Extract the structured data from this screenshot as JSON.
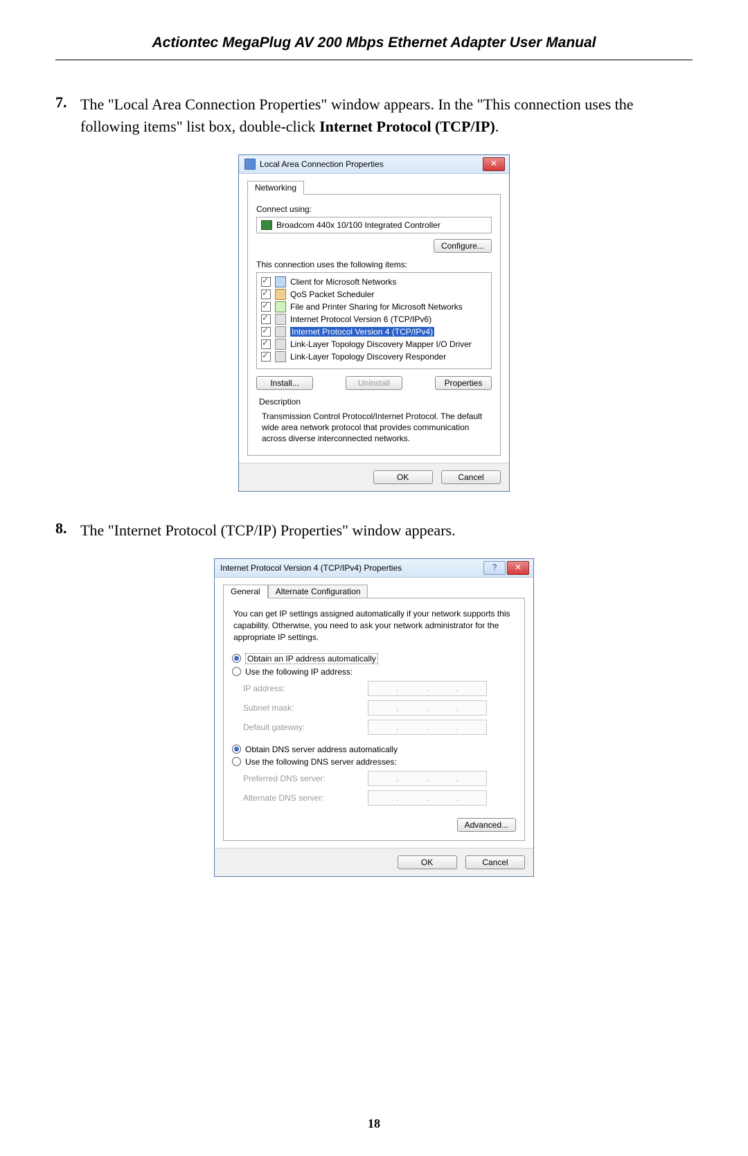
{
  "header": {
    "title": "Actiontec MegaPlug AV 200 Mbps Ethernet Adapter User Manual"
  },
  "page_number": "18",
  "step7": {
    "num": "7.",
    "pre": "The \"Local Area Connection Properties\" window appears. In the \"This connection uses the following items\" list box, double-click ",
    "bold": "Internet Protocol (TCP/IP)",
    "post": "."
  },
  "step8": {
    "num": "8.",
    "pre": "The \"Internet Protocol (",
    "sc": "TCP/IP",
    "post": ") Properties\" window appears."
  },
  "dlg1": {
    "title": "Local Area Connection Properties",
    "tab": "Networking",
    "connect_using": "Connect using:",
    "adapter": "Broadcom 440x 10/100 Integrated Controller",
    "configure": "Configure...",
    "uses_label": "This connection uses the following items:",
    "items": {
      "i0": "Client for Microsoft Networks",
      "i1": "QoS Packet Scheduler",
      "i2": "File and Printer Sharing for Microsoft Networks",
      "i3": "Internet Protocol Version 6 (TCP/IPv6)",
      "i4": "Internet Protocol Version 4 (TCP/IPv4)",
      "i5": "Link-Layer Topology Discovery Mapper I/O Driver",
      "i6": "Link-Layer Topology Discovery Responder"
    },
    "install": "Install...",
    "uninstall": "Uninstall",
    "properties": "Properties",
    "desc_label": "Description",
    "desc": "Transmission Control Protocol/Internet Protocol. The default wide area network protocol that provides communication across diverse interconnected networks.",
    "ok": "OK",
    "cancel": "Cancel"
  },
  "dlg2": {
    "title": "Internet Protocol Version 4 (TCP/IPv4) Properties",
    "tab_general": "General",
    "tab_alt": "Alternate Configuration",
    "intro": "You can get IP settings assigned automatically if your network supports this capability. Otherwise, you need to ask your network administrator for the appropriate IP settings.",
    "r_ip_auto": "Obtain an IP address automatically",
    "r_ip_manual": "Use the following IP address:",
    "f_ip": "IP address:",
    "f_mask": "Subnet mask:",
    "f_gw": "Default gateway:",
    "r_dns_auto": "Obtain DNS server address automatically",
    "r_dns_manual": "Use the following DNS server addresses:",
    "f_pdns": "Preferred DNS server:",
    "f_adns": "Alternate DNS server:",
    "advanced": "Advanced...",
    "ok": "OK",
    "cancel": "Cancel"
  }
}
